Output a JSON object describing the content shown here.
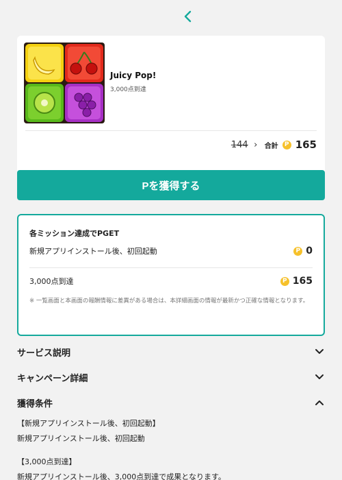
{
  "nav": {
    "back_icon": "chevron-left-icon",
    "accent": "#14a99c"
  },
  "app": {
    "title": "Juicy Pop!",
    "subtitle": "3,000点到達",
    "icon": "fruit-puzzle-app-icon"
  },
  "price": {
    "old": "144",
    "total_label": "合計",
    "coin_symbol": "P",
    "new": "165"
  },
  "cta": {
    "label": "Pを獲得する",
    "color": "#14a99c"
  },
  "missions": {
    "title": "各ミッション達成でPGET",
    "items": [
      {
        "label": "新規アプリインストール後、初回起動",
        "points": "0"
      },
      {
        "label": "3,000点到達",
        "points": "165"
      }
    ],
    "note": "※ 一覧画面と本画面の報酬情報に差異がある場合は、本詳細画面の情報が最新かつ正確な情報となります。"
  },
  "sections": {
    "service": {
      "label": "サービス説明",
      "state": "collapsed"
    },
    "campaign": {
      "label": "キャンペーン詳細",
      "state": "collapsed"
    },
    "conditions": {
      "label": "獲得条件",
      "state": "expanded",
      "lines": [
        "【新規アプリインストール後、初回起動】",
        "新規アプリインストール後、初回起動",
        "【3,000点到達】",
        "新規アプリインストール後、3,000点到達で成果となります。"
      ]
    }
  }
}
